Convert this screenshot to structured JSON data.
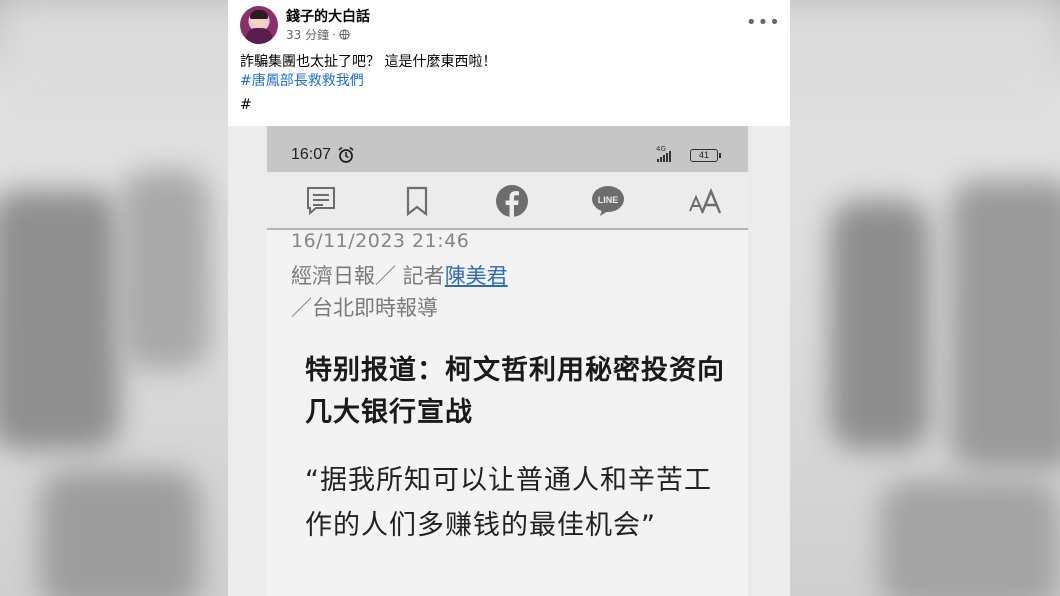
{
  "post": {
    "author": "錢子的大白話",
    "time": "33 分鐘",
    "separator": "·",
    "visibility_icon": "globe-icon",
    "more_icon": "more-options-icon",
    "more_label": "•••",
    "text_line1": "詐騙集團也太扯了吧？ 這是什麼東西啦！",
    "hashtag": "#唐鳳部長救救我們",
    "text_line3": "#"
  },
  "screenshot": {
    "status_bar": {
      "time": "16:07",
      "network": "4G",
      "battery": "41"
    },
    "toolbar_icons": [
      "comment-icon",
      "bookmark-icon",
      "facebook-icon",
      "line-icon",
      "font-size-icon"
    ],
    "line_label": "LINE",
    "article": {
      "date": "16/11/2023 21:46",
      "source_prefix": "經濟日報／ 記者",
      "reporter": "陳美君",
      "source_suffix": "／台北即時報導",
      "headline": "特别报道：柯文哲利用秘密投资向几大银行宣战",
      "quote": "“据我所知可以让普通人和辛苦工作的人们多赚钱的最佳机会”"
    }
  }
}
